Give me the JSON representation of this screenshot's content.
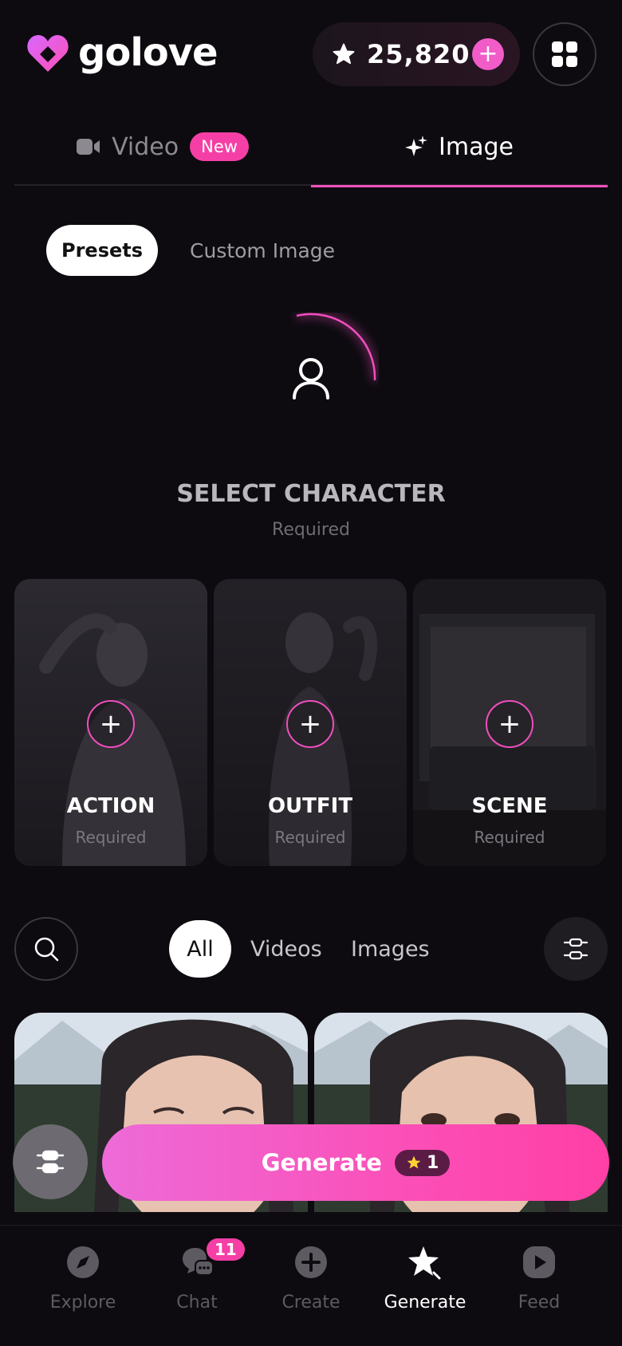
{
  "brand": {
    "name": "golove"
  },
  "credits": {
    "value": "25,820",
    "add": "+"
  },
  "main_tabs": [
    {
      "label": "Video",
      "badge": "New"
    },
    {
      "label": "Image"
    }
  ],
  "sub_tabs": {
    "presets": "Presets",
    "custom": "Custom Image"
  },
  "character": {
    "title": "SELECT CHARACTER",
    "required": "Required"
  },
  "preset_cards": [
    {
      "label": "ACTION",
      "required": "Required"
    },
    {
      "label": "OUTFIT",
      "required": "Required"
    },
    {
      "label": "SCENE",
      "required": "Required"
    }
  ],
  "filters": {
    "all": "All",
    "videos": "Videos",
    "images": "Images"
  },
  "generate": {
    "label": "Generate",
    "cost": "1"
  },
  "nav": [
    {
      "label": "Explore"
    },
    {
      "label": "Chat",
      "badge": "11"
    },
    {
      "label": "Create"
    },
    {
      "label": "Generate"
    },
    {
      "label": "Feed"
    }
  ],
  "colors": {
    "accent": "#f04ebd",
    "background": "#0d0b10",
    "badge": "#f53fa6"
  }
}
